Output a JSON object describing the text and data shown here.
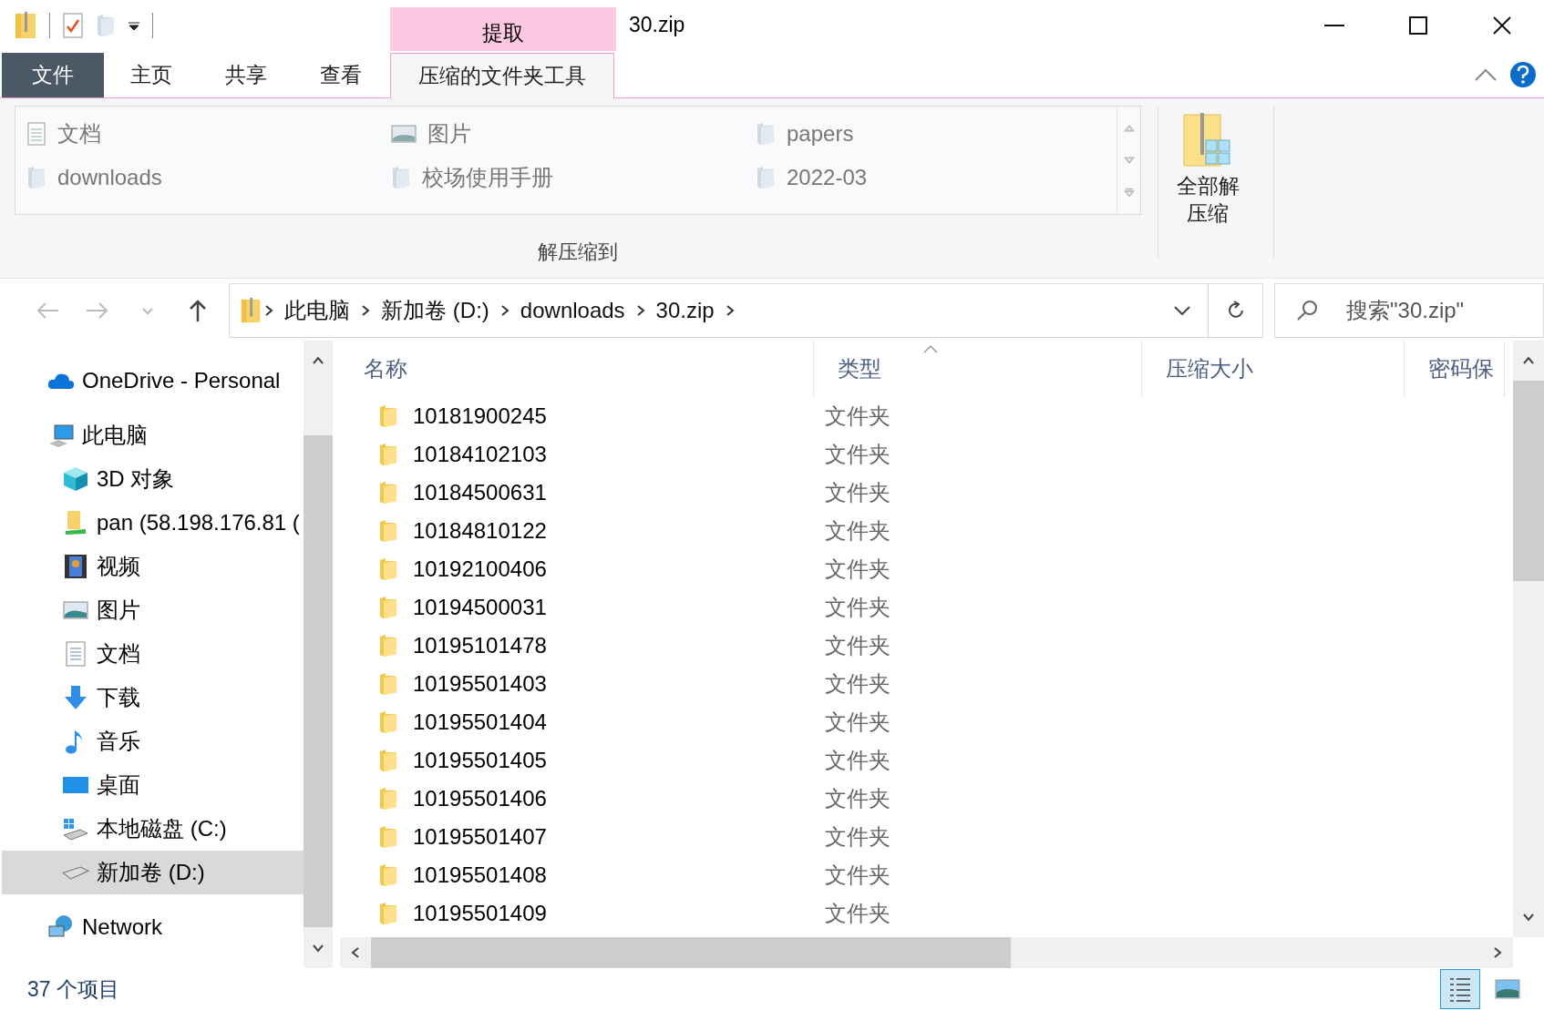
{
  "window": {
    "title": "30.zip"
  },
  "context_tab_group": {
    "label": "提取"
  },
  "ribbon_tabs": [
    {
      "label": "文件",
      "kind": "file",
      "selected": false
    },
    {
      "label": "主页",
      "kind": "tab",
      "selected": false
    },
    {
      "label": "共享",
      "kind": "tab",
      "selected": false
    },
    {
      "label": "查看",
      "kind": "tab",
      "selected": false
    },
    {
      "label": "压缩的文件夹工具",
      "kind": "tab",
      "selected": true
    }
  ],
  "ribbon": {
    "destinations": [
      {
        "label": "文档",
        "kind": "document"
      },
      {
        "label": "图片",
        "kind": "picture"
      },
      {
        "label": "papers",
        "kind": "folder"
      },
      {
        "label": "downloads",
        "kind": "folder"
      },
      {
        "label": "校场使用手册",
        "kind": "folder"
      },
      {
        "label": "2022-03",
        "kind": "folder"
      }
    ],
    "group_label": "解压缩到",
    "extract_all": "全部解压缩"
  },
  "address": {
    "crumbs": [
      "此电脑",
      "新加卷 (D:)",
      "downloads",
      "30.zip"
    ]
  },
  "search": {
    "placeholder": "搜索\"30.zip\""
  },
  "sidebar": {
    "items": [
      {
        "label": "OneDrive - Personal",
        "kind": "cloud",
        "selected": false
      },
      {
        "label": "此电脑",
        "kind": "computer",
        "selected": false,
        "children": [
          {
            "label": "3D 对象",
            "kind": "cube",
            "selected": false
          },
          {
            "label": "pan (58.198.176.81 (",
            "kind": "netdrive",
            "selected": false
          },
          {
            "label": "视频",
            "kind": "video",
            "selected": false
          },
          {
            "label": "图片",
            "kind": "picture",
            "selected": false
          },
          {
            "label": "文档",
            "kind": "document",
            "selected": false
          },
          {
            "label": "下载",
            "kind": "download",
            "selected": false
          },
          {
            "label": "音乐",
            "kind": "music",
            "selected": false
          },
          {
            "label": "桌面",
            "kind": "desktop",
            "selected": false
          },
          {
            "label": "本地磁盘 (C:)",
            "kind": "windrive",
            "selected": false
          },
          {
            "label": "新加卷 (D:)",
            "kind": "drive",
            "selected": true
          }
        ]
      },
      {
        "label": "Network",
        "kind": "network",
        "selected": false
      }
    ]
  },
  "table": {
    "columns": [
      "名称",
      "类型",
      "压缩大小",
      "密码保"
    ],
    "rows": [
      {
        "name": "10181900245",
        "type": "文件夹"
      },
      {
        "name": "10184102103",
        "type": "文件夹"
      },
      {
        "name": "10184500631",
        "type": "文件夹"
      },
      {
        "name": "10184810122",
        "type": "文件夹"
      },
      {
        "name": "10192100406",
        "type": "文件夹"
      },
      {
        "name": "10194500031",
        "type": "文件夹"
      },
      {
        "name": "10195101478",
        "type": "文件夹"
      },
      {
        "name": "10195501403",
        "type": "文件夹"
      },
      {
        "name": "10195501404",
        "type": "文件夹"
      },
      {
        "name": "10195501405",
        "type": "文件夹"
      },
      {
        "name": "10195501406",
        "type": "文件夹"
      },
      {
        "name": "10195501407",
        "type": "文件夹"
      },
      {
        "name": "10195501408",
        "type": "文件夹"
      },
      {
        "name": "10195501409",
        "type": "文件夹"
      }
    ]
  },
  "status_bar": {
    "item_count": "37 个项目"
  },
  "view_buttons": [
    {
      "kind": "details",
      "selected": true
    },
    {
      "kind": "large_icons",
      "selected": false
    }
  ]
}
